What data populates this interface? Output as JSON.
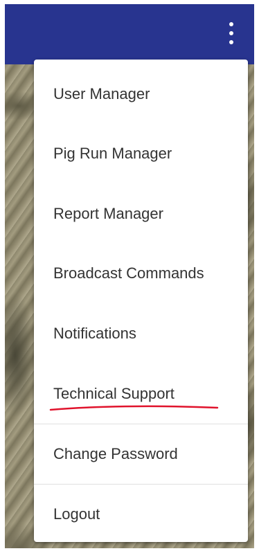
{
  "app_bar": {
    "color": "#28348f",
    "more_icon": "more-vert-icon"
  },
  "menu": {
    "items": [
      {
        "label": "User Manager"
      },
      {
        "label": "Pig Run Manager"
      },
      {
        "label": "Report Manager"
      },
      {
        "label": "Broadcast Commands"
      },
      {
        "label": "Notifications"
      },
      {
        "label": "Technical Support"
      },
      {
        "label": "Change Password"
      },
      {
        "label": "Logout"
      }
    ]
  },
  "annotation": {
    "underline_color": "#e0122b",
    "target": "Technical Support"
  }
}
